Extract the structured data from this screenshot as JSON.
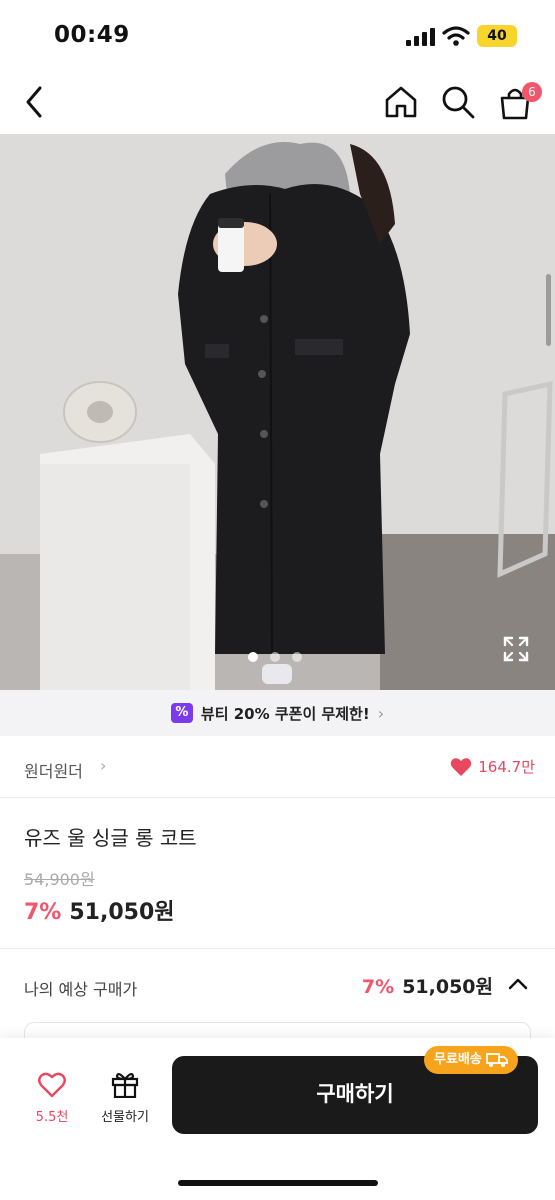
{
  "status_bar": {
    "time": "00:49",
    "battery": "40"
  },
  "nav": {
    "cart_count": "6"
  },
  "gallery": {
    "page_count": 3,
    "active_index": 0
  },
  "coupon": {
    "icon_text": "%",
    "text": "뷰티 20% 쿠폰이 무제한!",
    "chevron": "›"
  },
  "brand": {
    "name": "원더원더",
    "chevron": "›",
    "likes": "164.7만"
  },
  "product": {
    "title": "유즈 울 싱글 롱 코트",
    "original_price": "54,900원",
    "discount": "7%",
    "price": "51,050원"
  },
  "expected_price": {
    "label": "나의 예상 구매가",
    "discount": "7%",
    "price": "51,050원"
  },
  "bottom_bar": {
    "like_count": "5.5천",
    "gift_label": "선물하기",
    "buy_label": "구매하기",
    "shipping_badge": "무료배송"
  },
  "colors": {
    "accent": "#f0566c",
    "buy_button": "#1a1a1a",
    "shipping_badge": "#f7a31c",
    "coupon_icon": "#7c3aed"
  },
  "icons": [
    "back-icon",
    "home-icon",
    "search-icon",
    "shopping-bag-icon",
    "expand-icon",
    "heart-icon",
    "gift-icon",
    "truck-icon",
    "chevron-up-icon"
  ]
}
